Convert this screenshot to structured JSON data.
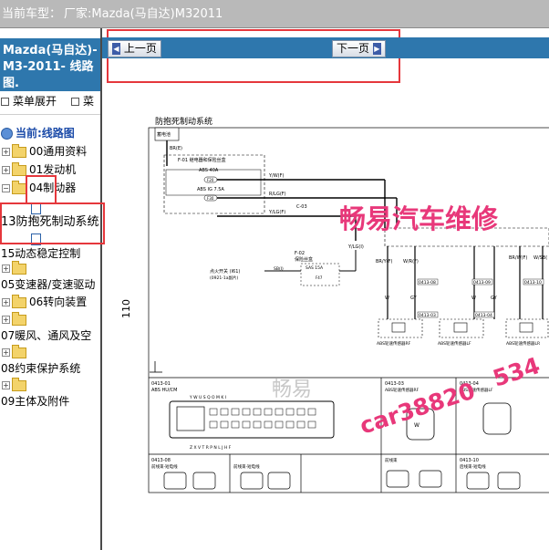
{
  "topbar": {
    "label": "当前车型：",
    "vehicle": "厂家:Mazda(马自达)M32011"
  },
  "sidebar": {
    "title_line1": "Mazda(马自达)-",
    "title_line2": "M3-2011- 线路",
    "title_line3": "图.",
    "expand_all": "菜单展开",
    "collapse_all": "菜",
    "current_label": "当前:线路图",
    "items": [
      {
        "label": "00通用资料"
      },
      {
        "label": "01发动机"
      },
      {
        "label": "04制动器"
      },
      {
        "label": "13防抱死制动系统"
      },
      {
        "label": "15动态稳定控制"
      },
      {
        "label": "05变速器/变速驱动"
      },
      {
        "label": "06转向装置"
      },
      {
        "label": "07暖风、通风及空"
      },
      {
        "label": "08约束保护系统"
      },
      {
        "label": "09主体及附件"
      }
    ]
  },
  "nav": {
    "prev": "上一页",
    "next": "下一页"
  },
  "diagram": {
    "title": "防抱死制动系统",
    "page_number": "110",
    "labels": {
      "battery": "蓄电池",
      "wire_brr": "BR(E)",
      "fuse_block": "F-01  继电器和保险丝盒",
      "fuse_abs40": "ABS 40A",
      "fuse_abs_ig": "ABS IG 7.5A",
      "f20": "F20",
      "f30": "F30",
      "wire1": "Y/W(F)",
      "wire2": "R/LG(F)",
      "wire3": "Y/LG(F)",
      "wire4": "Y/LG(I)",
      "conn_c03": "C-03",
      "f02": "F-02",
      "f02_desc": "保险丝盒",
      "sas15": "SAS 15A",
      "f47": "F47",
      "ignition": "点火开关 (I61)",
      "ignition_sub": "(0921-1a副片)",
      "sb": "SB(I)",
      "wire5": "BR/Y(F)",
      "wire6": "W/R(F)",
      "wire7": "BR/W(F)",
      "wire8": "W/SB(",
      "w": "W",
      "gy": "GY",
      "c1": "0413-08",
      "c2": "0413-03",
      "c3": "0413-04",
      "c4": "0413-09",
      "c5": "0413-10",
      "sensor_rf": "ABS轮速传感器RF",
      "sensor_lf": "ABS轮速传感器LF",
      "sensor_lr": "ABS轮速传感器LR",
      "sensor_rr": "ABS轮速传感器RR",
      "s_r": "R",
      "s_l": "L",
      "panel1_code": "0413-01",
      "panel1_title": "ABS HU/CM",
      "panel2_code": "0413-03",
      "panel2_title": "ABS轮速传感器RF",
      "panel3_code": "0413-04",
      "panel3_title": "ABS轮速传感器LF",
      "panel4_code": "0413-09",
      "panel4_title": "ABS轮速传感器LR",
      "panel5_code": "0413-10",
      "panel5_title": "ABS轮速传感器RR",
      "panel6_code": "0413-08",
      "panel6_title": "前线束-短电线",
      "panel7_title": "前线束-短电线",
      "panel8_title": "前线束",
      "panel9_code": "0413-10",
      "panel9_title": "后线束-短电线",
      "pins_top": "Y  W  U  S  Q  O  M  K  I",
      "pins_mid": "X  V  T  R  P  N  L  J",
      "pins_bot": "Z  X  V  T  R  P  N  L  J  H  F",
      "watermark1": "畅易汽车维修",
      "watermark2": "car38820",
      "watermark3": "534",
      "watermark4": "畅易"
    }
  }
}
